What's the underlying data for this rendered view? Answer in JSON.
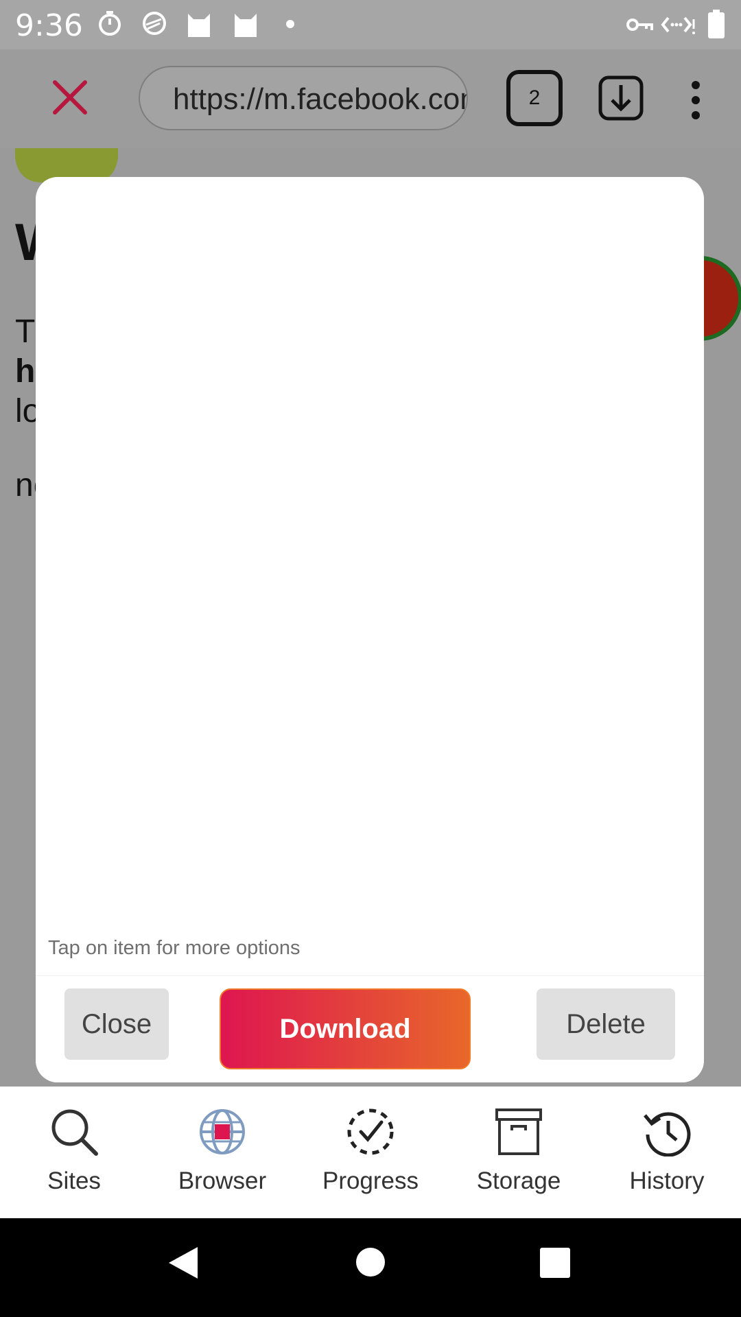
{
  "status_bar": {
    "time": "9:36"
  },
  "browser_bar": {
    "url": "https://m.facebook.com",
    "tab_count": "2"
  },
  "page_behind": {
    "fragments": [
      "W",
      "T",
      "ht",
      "lo",
      "no"
    ]
  },
  "dialog": {
    "hint": "Tap on item for more options",
    "close_label": "Close",
    "download_label": "Download",
    "delete_label": "Delete"
  },
  "bottom_nav": {
    "items": [
      {
        "label": "Sites",
        "icon": "search-icon"
      },
      {
        "label": "Browser",
        "icon": "globe-icon"
      },
      {
        "label": "Progress",
        "icon": "progress-check-icon"
      },
      {
        "label": "Storage",
        "icon": "archive-box-icon"
      },
      {
        "label": "History",
        "icon": "history-clock-icon"
      }
    ]
  },
  "colors": {
    "accent_start": "#de1650",
    "accent_end": "#e8672a",
    "close_x": "#b5173f"
  }
}
